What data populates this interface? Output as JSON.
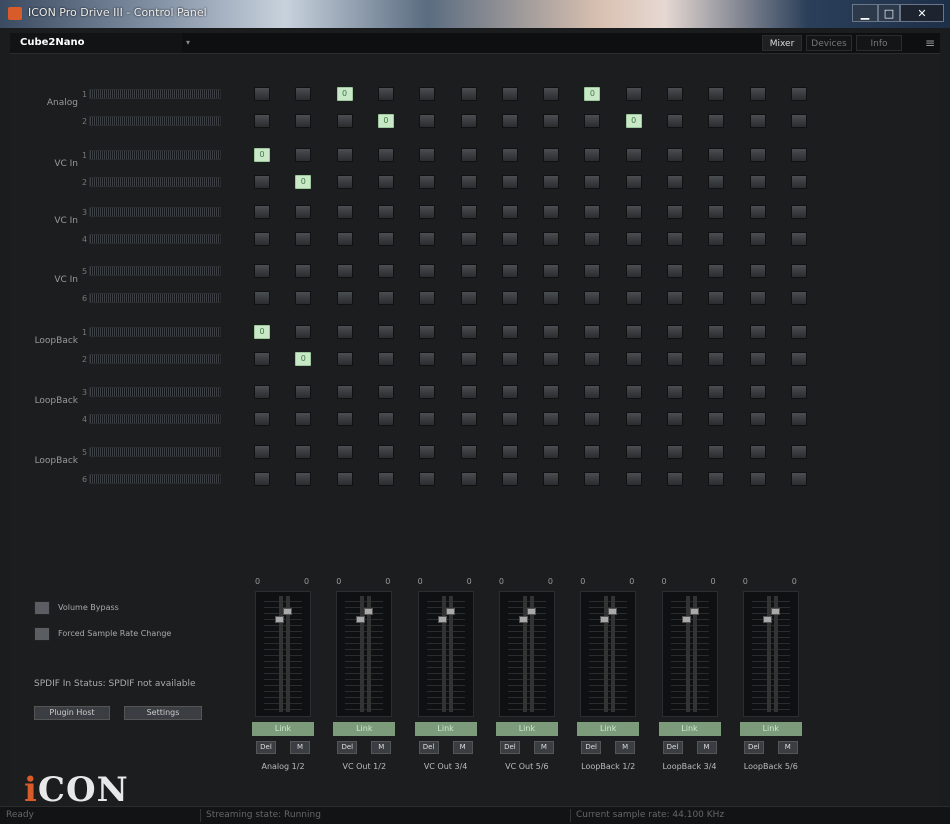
{
  "window": {
    "title": "ICON Pro Drive III - Control Panel",
    "minimize": "▁",
    "maximize": "□",
    "close": "✕"
  },
  "header": {
    "device": "Cube2Nano",
    "tabs": [
      "Mixer",
      "Devices",
      "Info"
    ],
    "menu_icon": "≡"
  },
  "matrix": {
    "rows": [
      {
        "group": "Analog",
        "ch": "1",
        "active_col": [
          2,
          8
        ]
      },
      {
        "group": "",
        "ch": "2",
        "active_col": [
          3,
          9
        ]
      },
      {
        "group": "VC In",
        "ch": "1",
        "active_col": [
          0
        ]
      },
      {
        "group": "",
        "ch": "2",
        "active_col": [
          1
        ]
      },
      {
        "group": "VC In",
        "ch": "3",
        "active_col": []
      },
      {
        "group": "",
        "ch": "4",
        "active_col": []
      },
      {
        "group": "VC In",
        "ch": "5",
        "active_col": []
      },
      {
        "group": "",
        "ch": "6",
        "active_col": []
      },
      {
        "group": "LoopBack",
        "ch": "1",
        "active_col": [
          0
        ]
      },
      {
        "group": "",
        "ch": "2",
        "active_col": [
          1
        ]
      },
      {
        "group": "LoopBack",
        "ch": "3",
        "active_col": []
      },
      {
        "group": "",
        "ch": "4",
        "active_col": []
      },
      {
        "group": "LoopBack",
        "ch": "5",
        "active_col": []
      },
      {
        "group": "",
        "ch": "6",
        "active_col": []
      }
    ],
    "columns": 14,
    "on_value": "0"
  },
  "strips": [
    {
      "label": "Analog 1/2",
      "peak_l": "0",
      "peak_r": "0",
      "link": "Link",
      "del": "Del",
      "mute": "M"
    },
    {
      "label": "VC Out 1/2",
      "peak_l": "0",
      "peak_r": "0",
      "link": "Link",
      "del": "Del",
      "mute": "M"
    },
    {
      "label": "VC Out 3/4",
      "peak_l": "0",
      "peak_r": "0",
      "link": "Link",
      "del": "Del",
      "mute": "M"
    },
    {
      "label": "VC Out 5/6",
      "peak_l": "0",
      "peak_r": "0",
      "link": "Link",
      "del": "Del",
      "mute": "M"
    },
    {
      "label": "LoopBack 1/2",
      "peak_l": "0",
      "peak_r": "0",
      "link": "Link",
      "del": "Del",
      "mute": "M"
    },
    {
      "label": "LoopBack 3/4",
      "peak_l": "0",
      "peak_r": "0",
      "link": "Link",
      "del": "Del",
      "mute": "M"
    },
    {
      "label": "LoopBack 5/6",
      "peak_l": "0",
      "peak_r": "0",
      "link": "Link",
      "del": "Del",
      "mute": "M"
    }
  ],
  "options": {
    "volume_bypass": "Volume Bypass",
    "forced_sample_rate": "Forced Sample Rate Change",
    "spdif_status": "SPDIF In Status: SPDIF not available",
    "plugin_host": "Plugin Host",
    "settings": "Settings"
  },
  "logo": {
    "text": "iCON"
  },
  "status": {
    "ready": "Ready",
    "streaming": "Streaming state: Running",
    "sample_rate": "Current sample rate: 44.100 KHz"
  },
  "colors": {
    "active_cell": "#c8e8c8",
    "link_green": "#7b9b7b",
    "logo_accent": "#d85b2a"
  }
}
